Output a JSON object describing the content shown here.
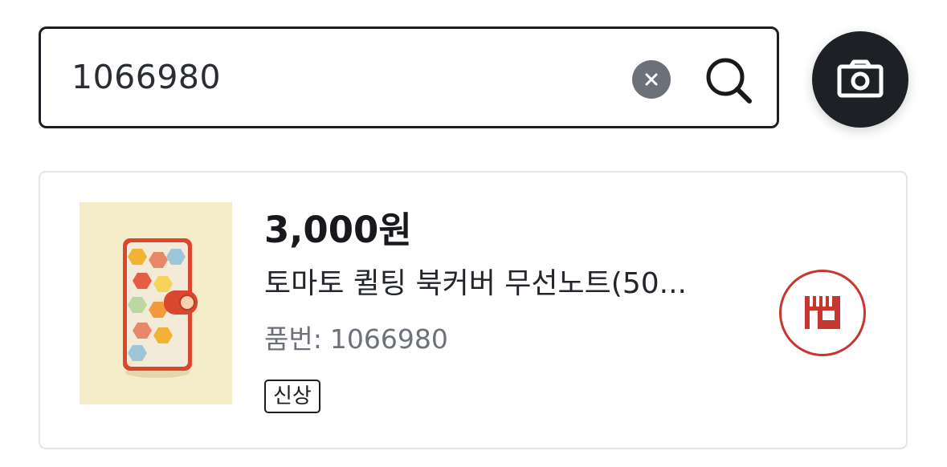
{
  "search": {
    "value": "1066980",
    "clear_icon": "close-icon",
    "search_icon": "search-icon"
  },
  "camera": {
    "icon": "camera-icon"
  },
  "product": {
    "price": "3,000원",
    "title": "토마토 퀼팅 북커버 무선노트(50...",
    "code_label": "품번:",
    "code_value": "1066980",
    "badge": "신상",
    "store_icon": "store-icon",
    "accent_color": "#c7372f"
  }
}
